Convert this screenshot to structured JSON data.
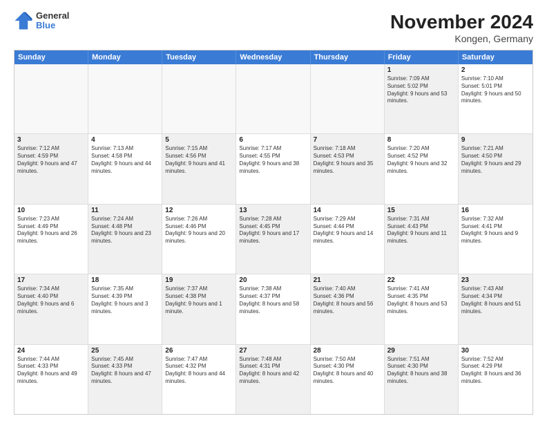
{
  "header": {
    "logo_line1": "General",
    "logo_line2": "Blue",
    "title": "November 2024",
    "subtitle": "Kongen, Germany"
  },
  "calendar": {
    "days_of_week": [
      "Sunday",
      "Monday",
      "Tuesday",
      "Wednesday",
      "Thursday",
      "Friday",
      "Saturday"
    ],
    "rows": [
      [
        {
          "day": "",
          "info": "",
          "empty": true
        },
        {
          "day": "",
          "info": "",
          "empty": true
        },
        {
          "day": "",
          "info": "",
          "empty": true
        },
        {
          "day": "",
          "info": "",
          "empty": true
        },
        {
          "day": "",
          "info": "",
          "empty": true
        },
        {
          "day": "1",
          "info": "Sunrise: 7:09 AM\nSunset: 5:02 PM\nDaylight: 9 hours and 53 minutes.",
          "shaded": true
        },
        {
          "day": "2",
          "info": "Sunrise: 7:10 AM\nSunset: 5:01 PM\nDaylight: 9 hours and 50 minutes.",
          "shaded": false
        }
      ],
      [
        {
          "day": "3",
          "info": "Sunrise: 7:12 AM\nSunset: 4:59 PM\nDaylight: 9 hours and 47 minutes.",
          "shaded": true
        },
        {
          "day": "4",
          "info": "Sunrise: 7:13 AM\nSunset: 4:58 PM\nDaylight: 9 hours and 44 minutes.",
          "shaded": false
        },
        {
          "day": "5",
          "info": "Sunrise: 7:15 AM\nSunset: 4:56 PM\nDaylight: 9 hours and 41 minutes.",
          "shaded": true
        },
        {
          "day": "6",
          "info": "Sunrise: 7:17 AM\nSunset: 4:55 PM\nDaylight: 9 hours and 38 minutes.",
          "shaded": false
        },
        {
          "day": "7",
          "info": "Sunrise: 7:18 AM\nSunset: 4:53 PM\nDaylight: 9 hours and 35 minutes.",
          "shaded": true
        },
        {
          "day": "8",
          "info": "Sunrise: 7:20 AM\nSunset: 4:52 PM\nDaylight: 9 hours and 32 minutes.",
          "shaded": false
        },
        {
          "day": "9",
          "info": "Sunrise: 7:21 AM\nSunset: 4:50 PM\nDaylight: 9 hours and 29 minutes.",
          "shaded": true
        }
      ],
      [
        {
          "day": "10",
          "info": "Sunrise: 7:23 AM\nSunset: 4:49 PM\nDaylight: 9 hours and 26 minutes.",
          "shaded": false
        },
        {
          "day": "11",
          "info": "Sunrise: 7:24 AM\nSunset: 4:48 PM\nDaylight: 9 hours and 23 minutes.",
          "shaded": true
        },
        {
          "day": "12",
          "info": "Sunrise: 7:26 AM\nSunset: 4:46 PM\nDaylight: 9 hours and 20 minutes.",
          "shaded": false
        },
        {
          "day": "13",
          "info": "Sunrise: 7:28 AM\nSunset: 4:45 PM\nDaylight: 9 hours and 17 minutes.",
          "shaded": true
        },
        {
          "day": "14",
          "info": "Sunrise: 7:29 AM\nSunset: 4:44 PM\nDaylight: 9 hours and 14 minutes.",
          "shaded": false
        },
        {
          "day": "15",
          "info": "Sunrise: 7:31 AM\nSunset: 4:43 PM\nDaylight: 9 hours and 11 minutes.",
          "shaded": true
        },
        {
          "day": "16",
          "info": "Sunrise: 7:32 AM\nSunset: 4:41 PM\nDaylight: 9 hours and 9 minutes.",
          "shaded": false
        }
      ],
      [
        {
          "day": "17",
          "info": "Sunrise: 7:34 AM\nSunset: 4:40 PM\nDaylight: 9 hours and 6 minutes.",
          "shaded": true
        },
        {
          "day": "18",
          "info": "Sunrise: 7:35 AM\nSunset: 4:39 PM\nDaylight: 9 hours and 3 minutes.",
          "shaded": false
        },
        {
          "day": "19",
          "info": "Sunrise: 7:37 AM\nSunset: 4:38 PM\nDaylight: 9 hours and 1 minute.",
          "shaded": true
        },
        {
          "day": "20",
          "info": "Sunrise: 7:38 AM\nSunset: 4:37 PM\nDaylight: 8 hours and 58 minutes.",
          "shaded": false
        },
        {
          "day": "21",
          "info": "Sunrise: 7:40 AM\nSunset: 4:36 PM\nDaylight: 8 hours and 56 minutes.",
          "shaded": true
        },
        {
          "day": "22",
          "info": "Sunrise: 7:41 AM\nSunset: 4:35 PM\nDaylight: 8 hours and 53 minutes.",
          "shaded": false
        },
        {
          "day": "23",
          "info": "Sunrise: 7:43 AM\nSunset: 4:34 PM\nDaylight: 8 hours and 51 minutes.",
          "shaded": true
        }
      ],
      [
        {
          "day": "24",
          "info": "Sunrise: 7:44 AM\nSunset: 4:33 PM\nDaylight: 8 hours and 49 minutes.",
          "shaded": false
        },
        {
          "day": "25",
          "info": "Sunrise: 7:45 AM\nSunset: 4:33 PM\nDaylight: 8 hours and 47 minutes.",
          "shaded": true
        },
        {
          "day": "26",
          "info": "Sunrise: 7:47 AM\nSunset: 4:32 PM\nDaylight: 8 hours and 44 minutes.",
          "shaded": false
        },
        {
          "day": "27",
          "info": "Sunrise: 7:48 AM\nSunset: 4:31 PM\nDaylight: 8 hours and 42 minutes.",
          "shaded": true
        },
        {
          "day": "28",
          "info": "Sunrise: 7:50 AM\nSunset: 4:30 PM\nDaylight: 8 hours and 40 minutes.",
          "shaded": false
        },
        {
          "day": "29",
          "info": "Sunrise: 7:51 AM\nSunset: 4:30 PM\nDaylight: 8 hours and 38 minutes.",
          "shaded": true
        },
        {
          "day": "30",
          "info": "Sunrise: 7:52 AM\nSunset: 4:29 PM\nDaylight: 8 hours and 36 minutes.",
          "shaded": false
        }
      ]
    ]
  }
}
